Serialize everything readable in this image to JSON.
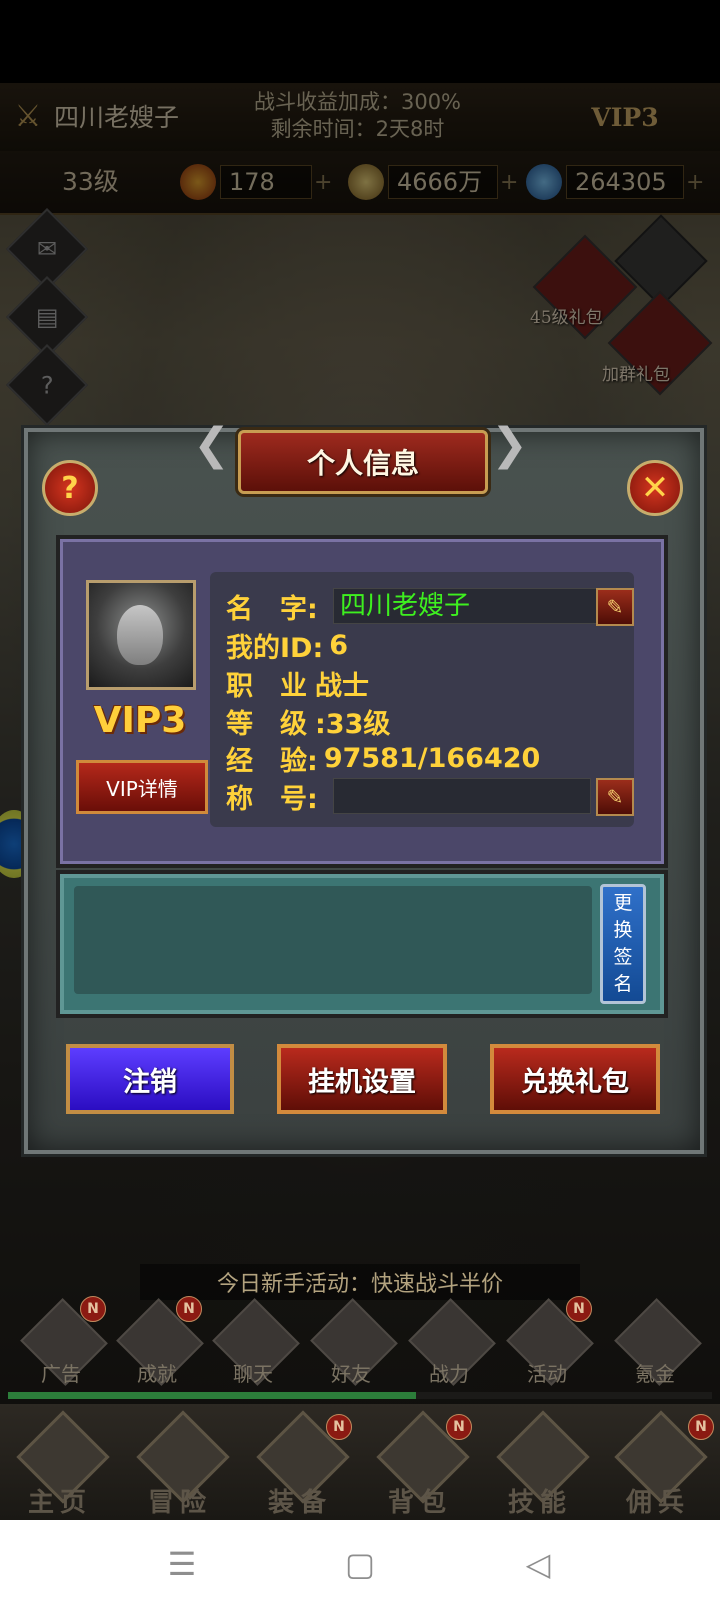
{
  "top_bar": {
    "player_name": "四川老嫂子",
    "bonus_line1": "战斗收益加成：300%",
    "bonus_line2": "剩余时间：2天8时",
    "vip": "VIP3"
  },
  "resources": {
    "level": "33级",
    "stamina": "178",
    "gold": "4666万",
    "diamond": "264305",
    "plus": "+"
  },
  "gifts": [
    {
      "label": "45级礼包"
    },
    {
      "label": "加群礼包"
    }
  ],
  "dialog": {
    "title": "个人信息",
    "help_icon": "?",
    "close_icon": "✕",
    "vip_badge": "VIP3",
    "vip_detail_label": "VIP详情",
    "fields": {
      "name_label": "名　字:",
      "name_value": "四川老嫂子",
      "id_label": "我的ID:",
      "id_value": "6",
      "job_label": "职　业",
      "job_value": "战士",
      "level_label": "等　级",
      "level_value": ":33级",
      "exp_label": "经　验:",
      "exp_value": "97581/166420",
      "title_label": "称　号:",
      "title_value": ""
    },
    "change_signature_label": [
      "更",
      "换",
      "签",
      "名"
    ],
    "buttons": {
      "logout": "注销",
      "afk_settings": "挂机设置",
      "redeem_gift": "兑换礼包"
    }
  },
  "notice": "今日新手活动：快速战斗半价",
  "function_bar": [
    {
      "label": "广告",
      "badge": "N"
    },
    {
      "label": "成就",
      "badge": "N"
    },
    {
      "label": "聊天",
      "badge": ""
    },
    {
      "label": "好友",
      "badge": ""
    },
    {
      "label": "战力",
      "badge": ""
    },
    {
      "label": "活动",
      "badge": "N"
    },
    {
      "label": "氪金",
      "badge": ""
    }
  ],
  "exp_progress_fraction": 0.58,
  "bottom_nav": [
    {
      "label": "主页",
      "badge": ""
    },
    {
      "label": "冒险",
      "badge": ""
    },
    {
      "label": "装备",
      "badge": "N"
    },
    {
      "label": "背包",
      "badge": "N"
    },
    {
      "label": "技能",
      "badge": ""
    },
    {
      "label": "佣兵",
      "badge": "N"
    }
  ],
  "system_nav": {
    "menu_icon": "☰",
    "home_icon": "▢",
    "back_icon": "◁"
  }
}
